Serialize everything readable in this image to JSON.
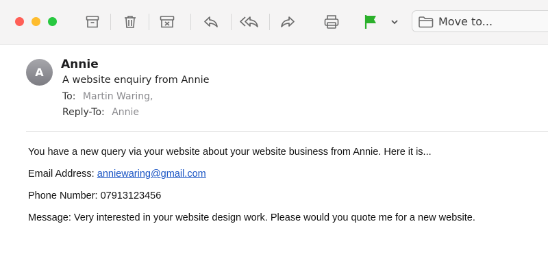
{
  "toolbar": {
    "buttons": [
      {
        "name": "archive-icon"
      },
      {
        "name": "trash-icon"
      },
      {
        "name": "junk-icon"
      },
      {
        "name": "reply-icon"
      },
      {
        "name": "reply-all-icon"
      },
      {
        "name": "forward-icon"
      },
      {
        "name": "print-icon"
      },
      {
        "name": "flag-icon",
        "color": "#2bb02b"
      },
      {
        "name": "chevron-down-icon"
      }
    ],
    "move_to": {
      "label": "Move to...",
      "icon": "folder-icon"
    }
  },
  "window_controls": {
    "close_color": "#ff5f57",
    "minimize_color": "#febc2e",
    "zoom_color": "#28c840"
  },
  "message": {
    "avatar_initial": "A",
    "sender": "Annie",
    "subject": "A website enquiry from Annie",
    "to_label": "To:",
    "to_value": "Martin Waring,",
    "reply_to_label": "Reply-To:",
    "reply_to_value": "Annie",
    "body": {
      "intro": "You have a new query via your website about your website business from Annie. Here it is...",
      "email_label": "Email Address: ",
      "email_value": "anniewaring@gmail.com",
      "phone": "Phone Number: 07913123456",
      "message": "Message: Very interested in your website design work. Please would you quote me for a new website."
    }
  }
}
